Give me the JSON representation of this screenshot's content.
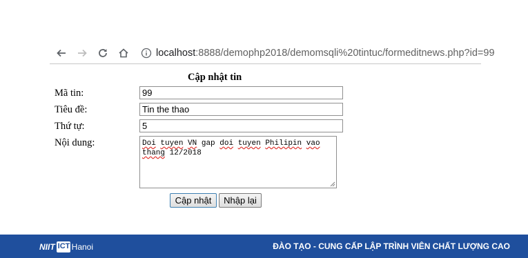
{
  "browser": {
    "url_host": "localhost",
    "url_path": ":8888/demophp2018/demomsqli%20tintuc/formeditnews.php?id=99",
    "icons": [
      "back-arrow-icon",
      "forward-arrow-icon",
      "reload-icon",
      "home-icon",
      "info-icon"
    ]
  },
  "form": {
    "title": "Cập nhật tin",
    "labels": {
      "id": "Mã tin:",
      "headline": "Tiêu đề:",
      "order": "Thứ tự:",
      "content": "Nội dung:"
    },
    "values": {
      "id": "99",
      "headline": "Tin the thao",
      "order": "5",
      "content_words_line1": [
        "Doi",
        "tuyen",
        "VN",
        "gap",
        "doi",
        "tuyen",
        "Philipin",
        "vao"
      ],
      "content_line2_word": "thang",
      "content_line2_rest": " 12/2018"
    },
    "buttons": {
      "update": "Cập nhật",
      "reset": "Nhập lại"
    }
  },
  "footer": {
    "logo_text": "NIIT",
    "logo_badge": "ICT",
    "logo_city": "Hanoi",
    "tagline": "ĐÀO TẠO - CUNG CẤP LẬP TRÌNH VIÊN CHẤT LƯỢNG CAO",
    "background": "#1f4f9d"
  }
}
